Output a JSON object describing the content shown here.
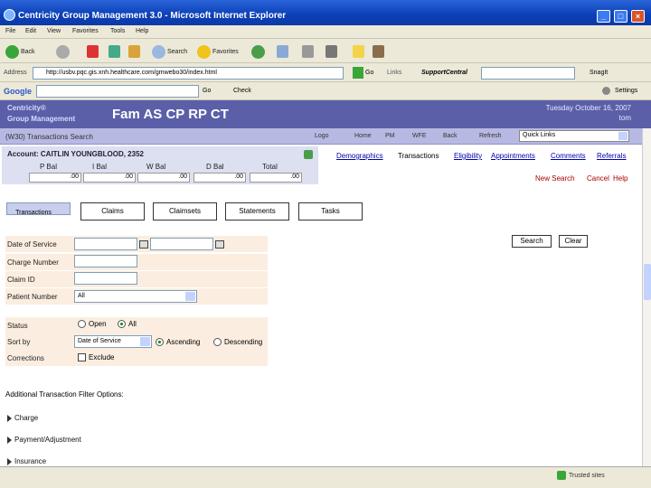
{
  "window": {
    "title": "Centricity Group Management 3.0 - Microsoft Internet Explorer"
  },
  "menu": [
    "File",
    "Edit",
    "View",
    "Favorites",
    "Tools",
    "Help"
  ],
  "toolbar": {
    "back": "Back",
    "search": "Search",
    "favorites": "Favorites"
  },
  "address": {
    "label": "Address",
    "url": "http://usbv.pqc.gis.xnh.healthcare.com/gmwebo30/index.html",
    "go": "Go",
    "links": "Links",
    "support": "SupportCentral",
    "snagit": "SnagIt"
  },
  "googlebar": {
    "brand": "Google",
    "go": "Go",
    "check": "Check",
    "settings": "Settings"
  },
  "app": {
    "brand_line1": "Centricity®",
    "brand_line2": "Group Management",
    "title": "Fam AS CP RP CT",
    "date": "Tuesday October 16, 2007",
    "user": "tom",
    "screen": "(W30) Transactions Search",
    "nav": [
      "Logo",
      "Home",
      "PM",
      "WFE",
      "Back",
      "Refresh"
    ],
    "quick_links": "Quick Links"
  },
  "account": {
    "label": "Account: CAITLIN YOUNGBLOOD, 2352",
    "balances": [
      {
        "label": "P Bal",
        "value": ".00"
      },
      {
        "label": "I Bal",
        "value": ".00"
      },
      {
        "label": "W Bal",
        "value": ".00"
      },
      {
        "label": "D Bal",
        "value": ".00"
      },
      {
        "label": "Total",
        "value": ".00"
      }
    ]
  },
  "account_links": [
    "Demographics",
    "Transactions",
    "Eligibility",
    "Appointments",
    "Comments",
    "Referrals"
  ],
  "page_links": [
    "New Search",
    "Cancel",
    "Help"
  ],
  "tabs": [
    "Transactions",
    "Claims",
    "Claimsets",
    "Statements",
    "Tasks"
  ],
  "form": {
    "date_of_service": "Date of Service",
    "charge_number": "Charge Number",
    "claim_id": "Claim ID",
    "patient_number": "Patient Number",
    "patient_number_value": "All",
    "status": "Status",
    "status_open": "Open",
    "status_all": "All",
    "sort_by": "Sort by",
    "sort_by_value": "Date of Service",
    "ascending": "Ascending",
    "descending": "Descending",
    "corrections": "Corrections",
    "exclude": "Exclude"
  },
  "buttons": {
    "search": "Search",
    "clear": "Clear"
  },
  "filters": {
    "heading": "Additional Transaction Filter Options:",
    "items": [
      "Charge",
      "Payment/Adjustment",
      "Insurance"
    ]
  },
  "status": {
    "zone": "Trusted sites"
  }
}
